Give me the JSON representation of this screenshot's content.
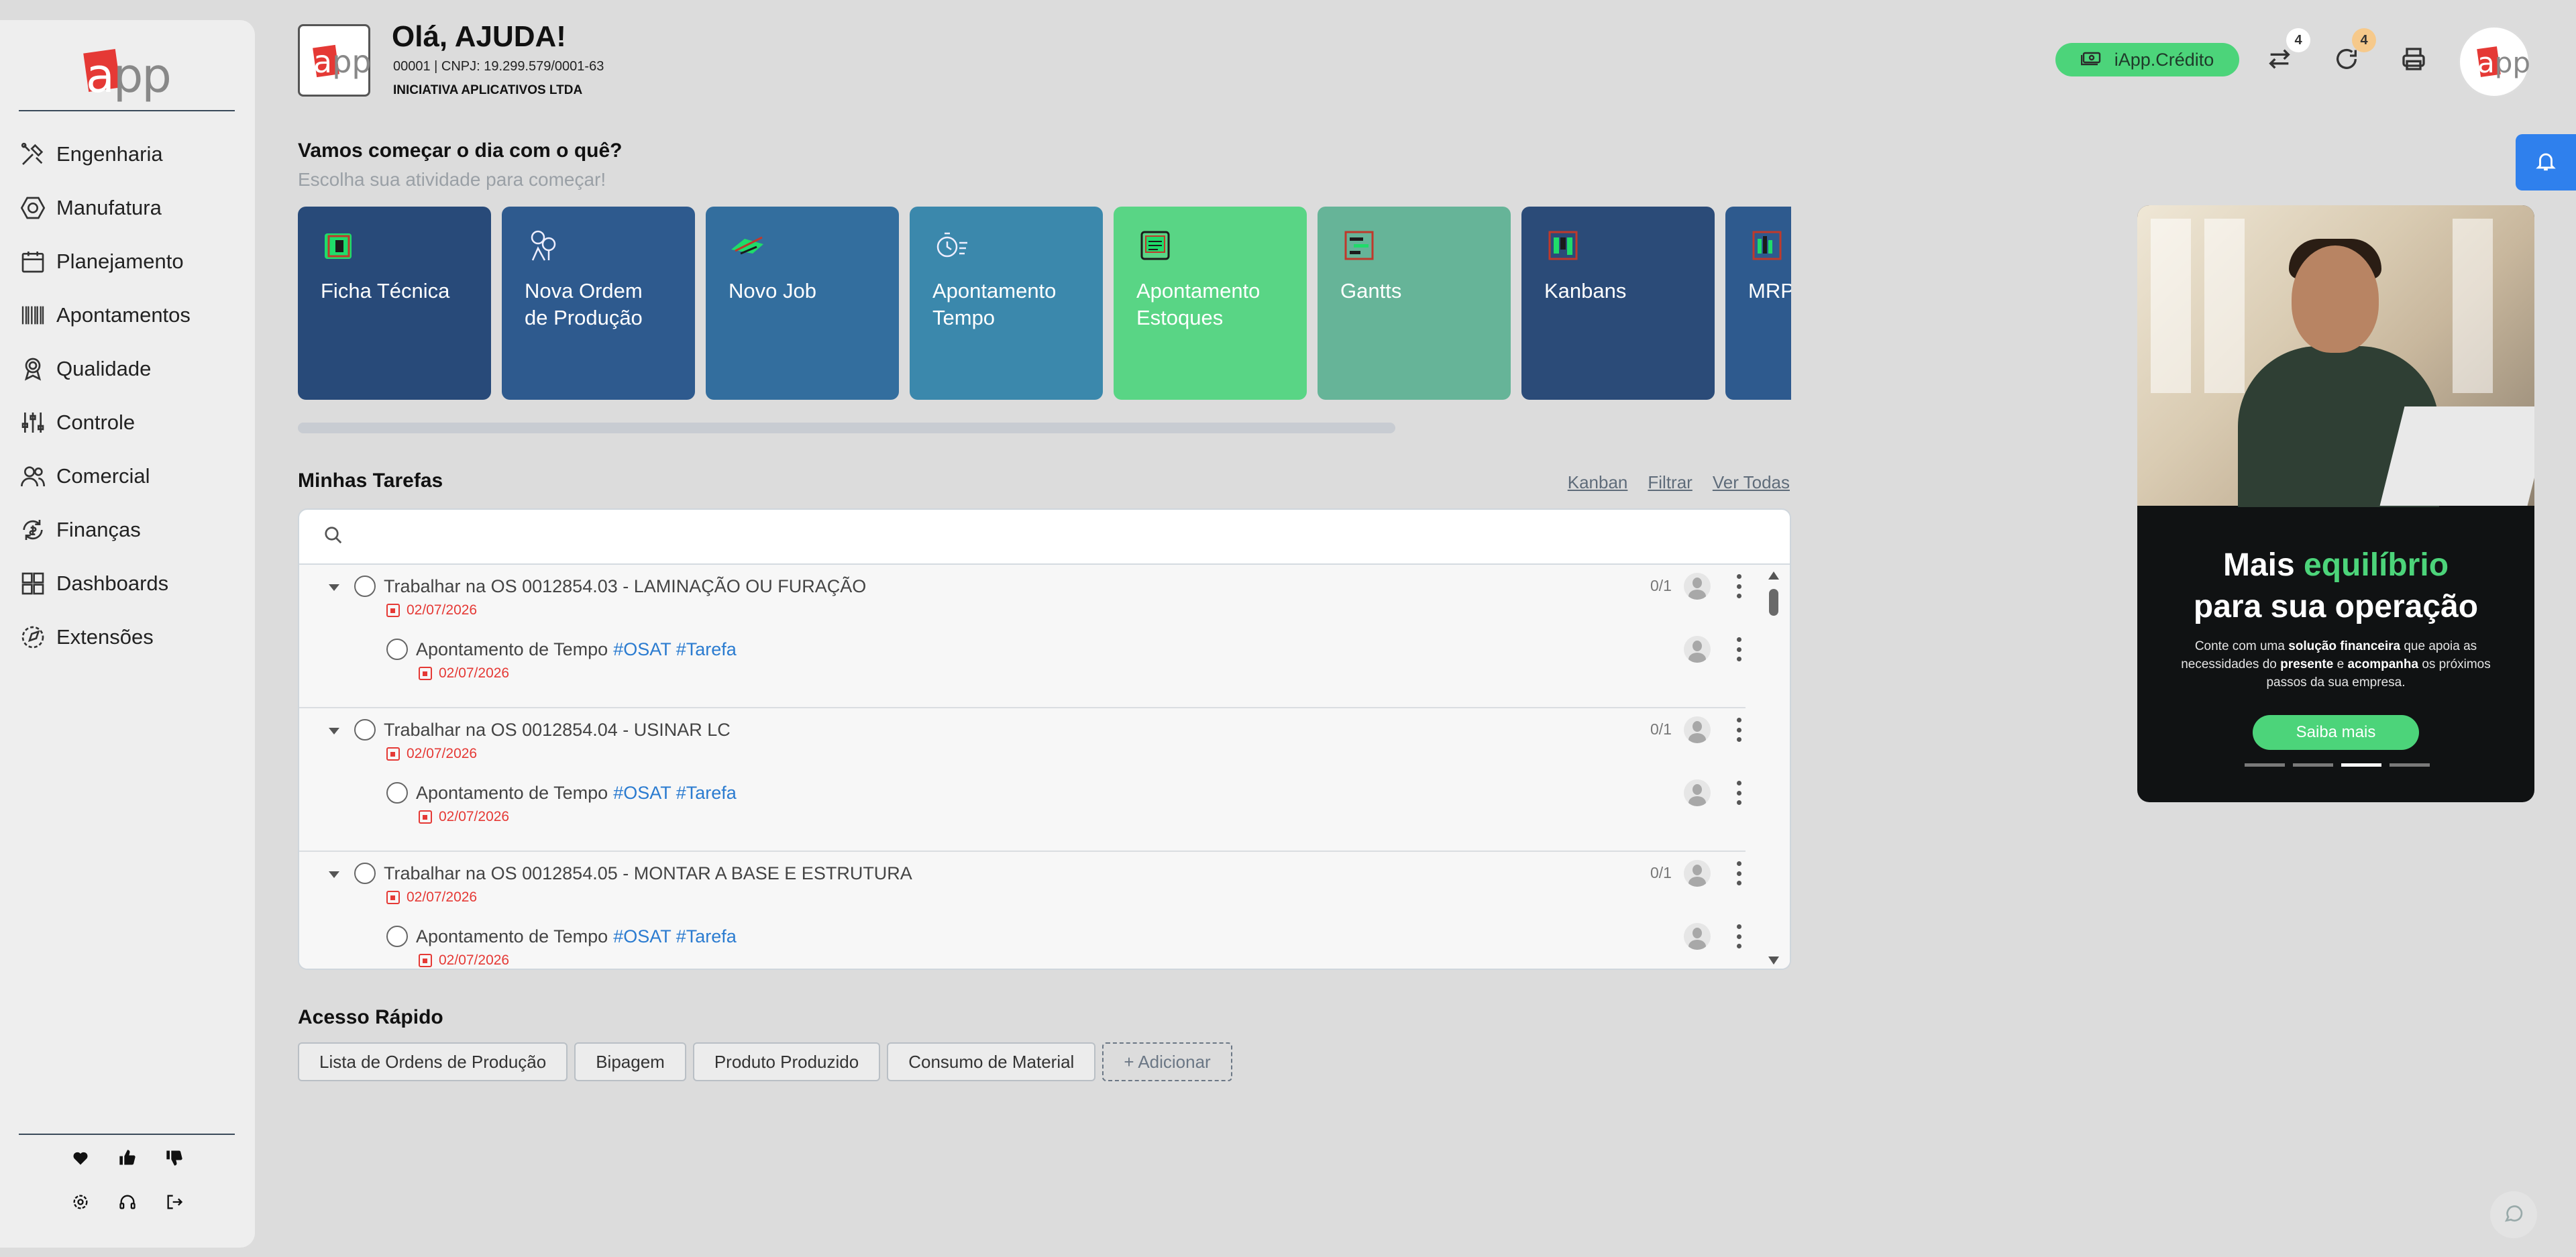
{
  "brand": {
    "logo_text_a": "a",
    "logo_text_rest": "pp"
  },
  "sidebar": {
    "items": [
      {
        "label": "Engenharia",
        "icon": "tools-icon"
      },
      {
        "label": "Manufatura",
        "icon": "hexagon-nut-icon"
      },
      {
        "label": "Planejamento",
        "icon": "calendar-icon"
      },
      {
        "label": "Apontamentos",
        "icon": "barcode-icon"
      },
      {
        "label": "Qualidade",
        "icon": "award-icon"
      },
      {
        "label": "Controle",
        "icon": "sliders-icon"
      },
      {
        "label": "Comercial",
        "icon": "users-icon"
      },
      {
        "label": "Finanças",
        "icon": "finance-icon"
      },
      {
        "label": "Dashboards",
        "icon": "grid-icon"
      },
      {
        "label": "Extensões",
        "icon": "compass-icon"
      }
    ]
  },
  "header": {
    "greeting": "Olá, AJUDA!",
    "cnpj": "00001 | CNPJ: 19.299.579/0001-63",
    "company": "INICIATIVA APLICATIVOS LTDA",
    "credit_label": "iApp.Crédito",
    "transfer_badge": "4",
    "sync_badge": "4"
  },
  "activities": {
    "title": "Vamos começar o dia com o quê?",
    "subtitle": "Escolha sua atividade para começar!",
    "cards": [
      {
        "label": "Ficha Técnica",
        "color": "#284a79"
      },
      {
        "label": "Nova Ordem\nde Produção",
        "color": "#2e5a8e"
      },
      {
        "label": "Novo Job",
        "color": "#336e9e"
      },
      {
        "label": "Apontamento\nTempo",
        "color": "#3b88ac"
      },
      {
        "label": "Apontamento\nEstoques",
        "color": "#59d585"
      },
      {
        "label": "Gantts",
        "color": "#66b498"
      },
      {
        "label": "Kanbans",
        "color": "#2b4b78"
      },
      {
        "label": "MRP",
        "color": "#2e5a8e"
      }
    ]
  },
  "tasks": {
    "title": "Minhas Tarefas",
    "links": {
      "kanban": "Kanban",
      "filter": "Filtrar",
      "all": "Ver Todas"
    },
    "search_placeholder": "",
    "groups": [
      {
        "title": "Trabalhar na OS 0012854.03 - LAMINAÇÃO OU FURAÇÃO",
        "date": "02/07/2026",
        "counter": "0/1",
        "sub": {
          "title": "Apontamento de Tempo",
          "tags": "#OSAT #Tarefa",
          "date": "02/07/2026"
        }
      },
      {
        "title": "Trabalhar na OS 0012854.04 - USINAR LC",
        "date": "02/07/2026",
        "counter": "0/1",
        "sub": {
          "title": "Apontamento de Tempo",
          "tags": "#OSAT #Tarefa",
          "date": "02/07/2026"
        }
      },
      {
        "title": "Trabalhar na OS 0012854.05 - MONTAR A BASE E ESTRUTURA",
        "date": "02/07/2026",
        "counter": "0/1",
        "sub": {
          "title": "Apontamento de Tempo",
          "tags": "#OSAT #Tarefa",
          "date": "02/07/2026"
        }
      }
    ]
  },
  "quick_access": {
    "title": "Acesso Rápido",
    "items": [
      "Lista de Ordens de Produção",
      "Bipagem",
      "Produto Produzido",
      "Consumo de Material"
    ],
    "add_label": "+ Adicionar"
  },
  "promo": {
    "title_line1_a": "Mais ",
    "title_line1_b": "equilíbrio",
    "title_line2": "para sua operação",
    "text_1": "Conte com uma ",
    "text_2": "solução financeira",
    "text_3": " que apoia as necessidades do ",
    "text_4": "presente",
    "text_5": " e ",
    "text_6": "acompanha",
    "text_7": " os próximos passos da sua empresa.",
    "button": "Saiba mais",
    "active_slide": 3,
    "slide_count": 4
  }
}
